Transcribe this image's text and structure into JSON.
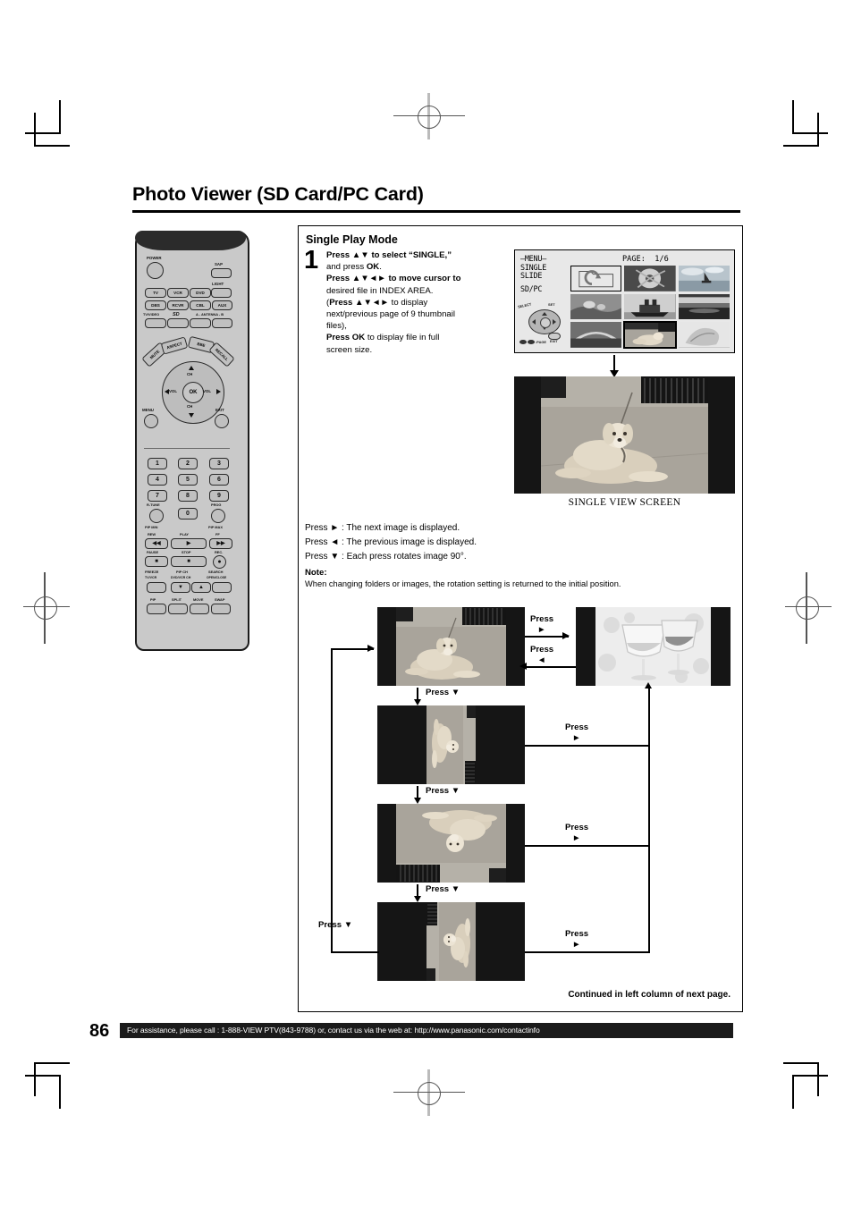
{
  "page": {
    "title": "Photo Viewer (SD Card/PC Card)",
    "number": "86",
    "footer_text": "For assistance, please call : 1-888-VIEW PTV(843-9788) or, contact us via the web at: http://www.panasonic.com/contactinfo"
  },
  "section": {
    "heading": "Single Play Mode",
    "step_number": "1",
    "step_lines": [
      "Press ▲▼ to select “SINGLE,”",
      "and press OK.",
      "Press ▲▼◄► to move cursor to",
      "desired file in INDEX AREA.",
      "(Press ▲▼◄► to display",
      "next/previous page of 9 thumbnail",
      "files),",
      "Press OK to display file in full",
      "screen size."
    ]
  },
  "osd": {
    "menu_label": "–MENU–",
    "mode_single": "SINGLE",
    "mode_slide": "SLIDE",
    "source": "SD/PC",
    "page_label": "PAGE:",
    "page_value": "1/6",
    "pad": {
      "select": "SELECT",
      "set": "SET",
      "exit": "EXIT",
      "page": ":PAGE"
    },
    "thumbnails": [
      {
        "name": "folder-up",
        "type": "folder"
      },
      {
        "name": "flower-photo",
        "type": "photo"
      },
      {
        "name": "sailboat-photo",
        "type": "photo"
      },
      {
        "name": "birds-photo",
        "type": "photo"
      },
      {
        "name": "ship-photo",
        "type": "photo"
      },
      {
        "name": "sunset-sea-photo",
        "type": "photo"
      },
      {
        "name": "bridge-photo",
        "type": "photo"
      },
      {
        "name": "dog-photo",
        "type": "photo",
        "selected": true
      },
      {
        "name": "leaf-photo",
        "type": "photo"
      }
    ]
  },
  "single_view": {
    "caption": "SINGLE VIEW SCREEN",
    "image_name": "dog-on-leash-photo"
  },
  "press_list": [
    "Press ► : The next image is displayed.",
    "Press ◄ : The previous image is displayed.",
    "Press ▼ : Each press rotates image 90°."
  ],
  "note": {
    "heading": "Note:",
    "text": "When changing folders or images, the rotation setting is returned to the initial position."
  },
  "flow": {
    "labels": {
      "press_right_1": "Press\n►",
      "press_left_1": "Press\n◄",
      "press_down_1": "Press ▼",
      "press_down_2": "Press ▼",
      "press_down_3": "Press ▼",
      "press_down_4": "Press ▼",
      "press_right_2": "Press\n►",
      "press_right_3": "Press\n►",
      "press_right_4": "Press\n►"
    },
    "label_press": "Press",
    "arrow_right": "►",
    "arrow_left": "◄",
    "arrow_down": "▼",
    "press_down_label": "Press ▼",
    "continued": "Continued in left column of next page.",
    "screens": [
      {
        "name": "dog-rotation-0",
        "rotation": "0"
      },
      {
        "name": "wine-glasses-photo",
        "rotation": "0"
      },
      {
        "name": "dog-rotation-90",
        "rotation": "90"
      },
      {
        "name": "dog-rotation-180",
        "rotation": "180"
      },
      {
        "name": "dog-rotation-270",
        "rotation": "270"
      }
    ]
  },
  "remote": {
    "power": "POWER",
    "sap": "SAP",
    "light": "LIGHT",
    "device_row1": [
      "TV",
      "VCR",
      "DVD"
    ],
    "device_row2": [
      "DBS",
      "RCVR",
      "CBL",
      "AUX"
    ],
    "tv_video": "TV/VIDEO",
    "sd_logo": "SD",
    "antenna": "A - ANTENNA - B",
    "arc_buttons": [
      "MUTE",
      "ASPECT",
      "BBE",
      "RECALL"
    ],
    "nav": {
      "ch_up": "CH",
      "ch_down": "CH",
      "vol_left": "VOL",
      "vol_right": "VOL",
      "ok": "OK"
    },
    "menu": "MENU",
    "exit": "EXIT",
    "numbers": [
      "1",
      "2",
      "3",
      "4",
      "5",
      "6",
      "7",
      "8",
      "9",
      "0"
    ],
    "r_tune": "R-TUNE",
    "prog": "PROG",
    "pip_min": "PIP MIN",
    "pip_max": "PIP MAX",
    "rew": "REW",
    "play": "PLAY",
    "ff": "FF",
    "pause": "PAUSE",
    "stop": "STOP",
    "rec": "REC.",
    "freeze": "FREEZE",
    "tv_vcr": "TV/VCR",
    "pip_ch": "PIP CH",
    "dvd_vcr_ch": "DVD/VCR CH",
    "search": "SEARCH",
    "open_close": "OPEN/CLOSE",
    "bottom_row": [
      "PIP",
      "SPLIT",
      "MOVE",
      "SWAP"
    ]
  }
}
